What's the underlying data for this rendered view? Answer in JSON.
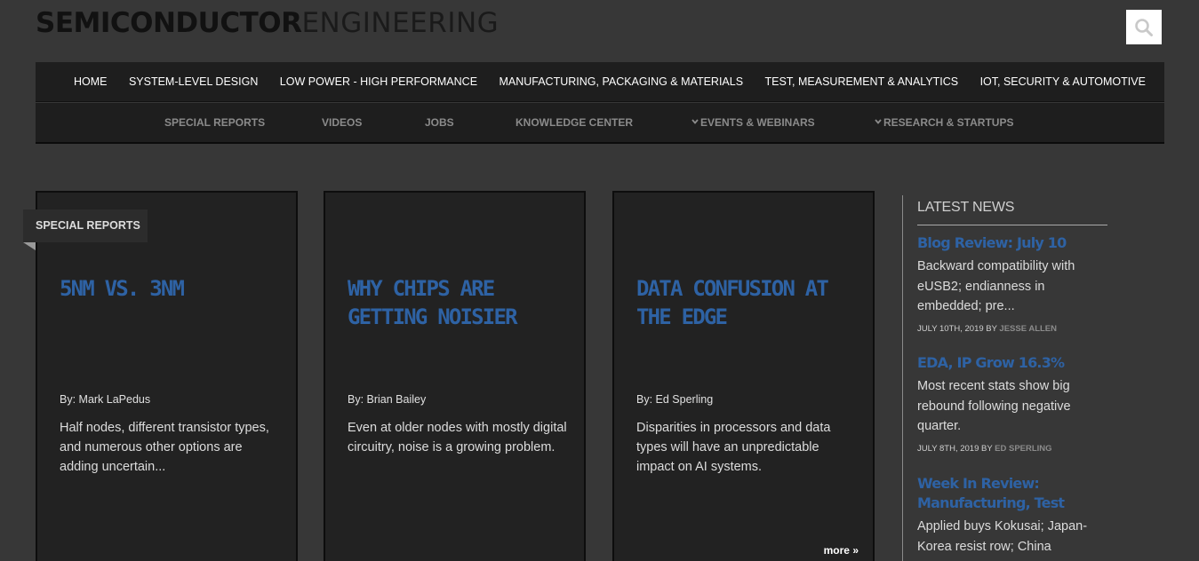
{
  "site": {
    "logo_bold": "SEMICONDUCTOR",
    "logo_light": "ENGINEERING"
  },
  "nav_primary": [
    "HOME",
    "SYSTEM-LEVEL DESIGN",
    "LOW POWER - HIGH PERFORMANCE",
    "MANUFACTURING, PACKAGING & MATERIALS",
    "TEST, MEASUREMENT & ANALYTICS",
    "IOT, SECURITY & AUTOMOTIVE"
  ],
  "nav_secondary": [
    "SPECIAL REPORTS",
    "VIDEOS",
    "JOBS",
    "KNOWLEDGE CENTER",
    "EVENTS & WEBINARS",
    "RESEARCH & STARTUPS"
  ],
  "badge": "SPECIAL REPORTS",
  "cards": [
    {
      "title": "5NM VS. 3NM",
      "author": "By: Mark LaPedus",
      "excerpt": "Half nodes, different transistor types, and numerous other options are adding uncertain..."
    },
    {
      "title": "WHY CHIPS ARE GETTING NOISIER",
      "author": "By: Brian Bailey",
      "excerpt": "Even at older nodes with mostly digital circuitry, noise is a growing problem."
    },
    {
      "title": "DATA CONFUSION AT THE EDGE",
      "author": "By: Ed Sperling",
      "excerpt": "Disparities in processors and data types will have an unpredictable impact on AI systems.",
      "more": "more »"
    }
  ],
  "sidebar": {
    "heading": "LATEST NEWS",
    "items": [
      {
        "title": "Blog Review: July 10",
        "excerpt": "Backward compatibility with eUSB2; endianness in embedded; pre...",
        "date": "JULY 10TH, 2019 BY ",
        "author": "JESSE ALLEN"
      },
      {
        "title": "EDA, IP Grow 16.3%",
        "excerpt": "Most recent stats show big rebound following negative quarter.",
        "date": "JULY 8TH, 2019 BY ",
        "author": "ED SPERLING"
      },
      {
        "title": "Week In Review: Manufacturing, Test",
        "excerpt": "Applied buys Kokusai; Japan-Korea resist row; China DRAM."
      }
    ]
  },
  "colors": {
    "background": "#373737",
    "nav": "#1e1e1e",
    "accent": "#2e62a4",
    "card": "#222222"
  },
  "icons": {
    "search": "search-icon",
    "chevron": "chevron-down-icon"
  }
}
